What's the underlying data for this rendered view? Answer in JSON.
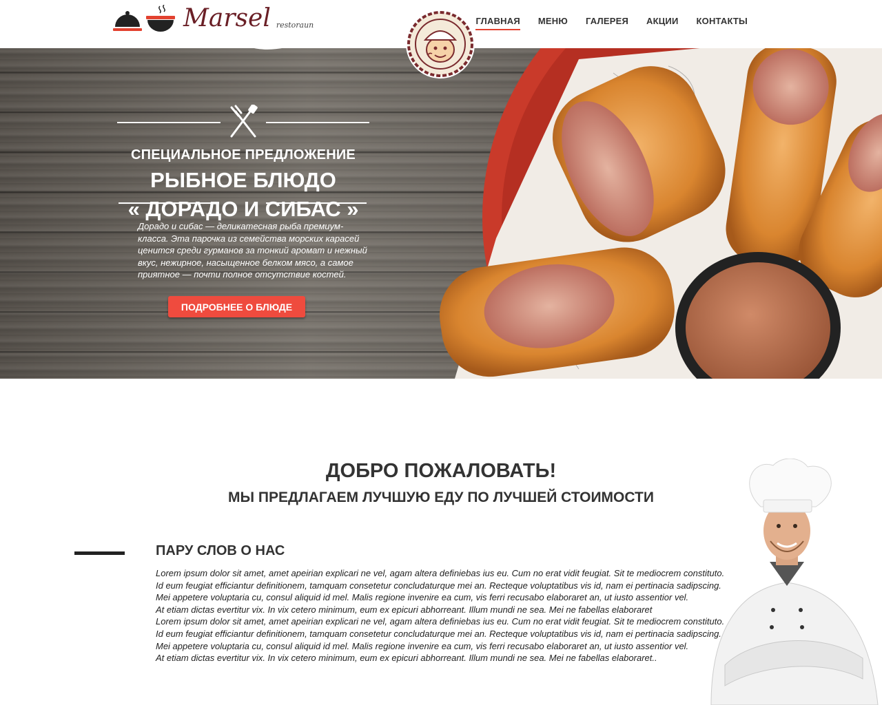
{
  "header": {
    "brand_name": "Marsel",
    "brand_sub": "restoraun",
    "nav": [
      {
        "label": "ГЛАВНАЯ",
        "active": true
      },
      {
        "label": "МЕНЮ",
        "active": false
      },
      {
        "label": "ГАЛЕРЕЯ",
        "active": false
      },
      {
        "label": "АКЦИИ",
        "active": false
      },
      {
        "label": "КОНТАКТЫ",
        "active": false
      }
    ]
  },
  "hero": {
    "kicker": "СПЕЦИАЛЬНОЕ ПРЕДЛОЖЕНИЕ",
    "title_line1": "РЫБНОЕ БЛЮДО",
    "title_line2": "« ДОРАДО И СИБАС »",
    "description": "Дорадо и сибас — деликатесная рыба премиум-класса. Эта парочка из семейства морских карасей ценится среди гурманов  за тонкий аромат и нежный вкус, нежирное, насыщенное белком мясо, а самое приятное — почти полное отсутствие костей.",
    "button_label": "ПОДРОБНЕЕ О БЛЮДЕ"
  },
  "welcome": {
    "title": "ДОБРО ПОЖАЛОВАТЬ!",
    "subtitle": "МЫ ПРЕДЛАГАЕМ ЛУЧШУЮ ЕДУ ПО ЛУЧШЕЙ СТОИМОСТИ",
    "about_title": "ПАРУ СЛОВ О НАС",
    "about_lines": [
      "Lorem ipsum dolor sit amet, amet apeirian explicari ne vel, agam altera definiebas ius eu. Cum no erat vidit feugiat. Sit te mediocrem constituto.",
      "Id eum feugiat efficiantur definitionem, tamquam consetetur concludaturque mei an. Recteque voluptatibus vis id, nam ei pertinacia sadipscing.",
      "Mei appetere voluptaria cu, consul aliquid id mel. Malis regione invenire ea cum, vis ferri recusabo elaboraret an, ut iusto assentior vel.",
      "At etiam dictas evertitur vix. In vix cetero minimum, eum ex epicuri abhorreant. Illum mundi ne sea. Mei ne fabellas elaboraret",
      "Lorem ipsum dolor sit amet, amet apeirian explicari ne vel, agam altera definiebas ius eu. Cum no erat vidit feugiat. Sit te mediocrem constituto.",
      "Id eum feugiat efficiantur definitionem, tamquam consetetur concludaturque mei an. Recteque voluptatibus vis id, nam ei pertinacia sadipscing.",
      "Mei appetere voluptaria cu, consul aliquid id mel. Malis regione invenire ea cum, vis ferri recusabo elaboraret an, ut iusto assentior vel.",
      "At etiam dictas evertitur vix. In vix cetero minimum, eum ex epicuri abhorreant. Illum mundi ne sea. Mei ne fabellas elaboraret.."
    ]
  },
  "colors": {
    "accent_red": "#ef4b3e",
    "brand_maroon": "#6a1f26"
  },
  "icons": [
    "cloche-icon",
    "pot-icon",
    "mascot-badge",
    "cutlery-icon",
    "chef-photo",
    "food-photo"
  ]
}
